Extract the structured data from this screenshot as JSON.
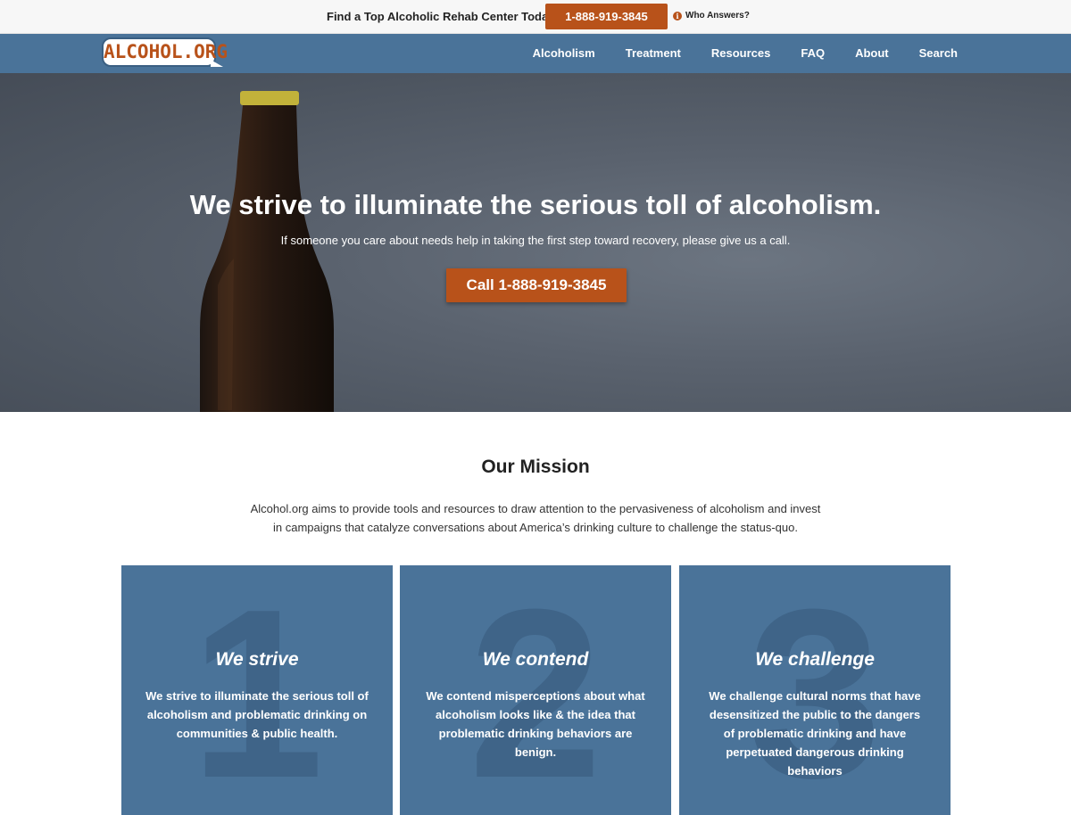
{
  "topbar": {
    "promo_text": "Find a Top Alcoholic Rehab Center Today.",
    "phone_button": "1-888-919-3845",
    "who_answers": "Who Answers?",
    "info_icon": "info-circle-icon"
  },
  "nav": {
    "logo_text": "ALCOHOL.ORG",
    "items": [
      {
        "label": "Alcoholism"
      },
      {
        "label": "Treatment"
      },
      {
        "label": "Resources"
      },
      {
        "label": "FAQ"
      },
      {
        "label": "About"
      },
      {
        "label": "Search"
      }
    ]
  },
  "hero": {
    "title": "We strive to illuminate the serious toll of alcoholism.",
    "subtitle": "If someone you care about needs help in taking the first step toward recovery, please give us a call.",
    "cta": "Call 1-888-919-3845"
  },
  "mission": {
    "title": "Our Mission",
    "text": "Alcohol.org aims to provide tools and resources to draw attention to the pervasiveness of alcoholism and invest in campaigns that catalyze conversations about America’s drinking culture to challenge the status-quo.",
    "cards": [
      {
        "number": "1",
        "title": "We strive",
        "text": "We strive to illuminate the serious toll of alcoholism and problematic drinking on communities & public health."
      },
      {
        "number": "2",
        "title": "We contend",
        "text": "We contend misperceptions about what alcoholism looks like & the idea that problematic drinking behaviors are benign."
      },
      {
        "number": "3",
        "title": "We challenge",
        "text": "We challenge cultural norms that have desensitized the public to the dangers of problematic drinking and have perpetuated dangerous drinking behaviors"
      }
    ]
  },
  "colors": {
    "accent": "#b8521a",
    "nav_blue": "#4a7399"
  }
}
